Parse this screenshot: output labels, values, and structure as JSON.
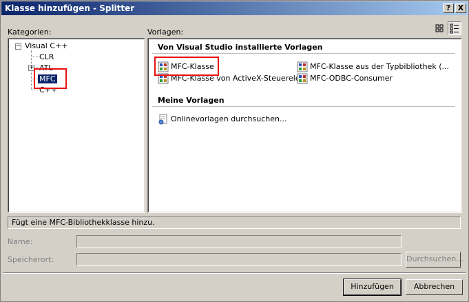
{
  "window": {
    "title": "Klasse hinzufügen - Splitter",
    "help_glyph": "?",
    "close_glyph": "X"
  },
  "categories": {
    "label": "Kategorien:",
    "tree": [
      {
        "label": "Visual C++",
        "expander": "−"
      },
      {
        "label": "CLR"
      },
      {
        "label": "ATL",
        "expander": "+"
      },
      {
        "label": "MFC",
        "selected": true
      },
      {
        "label": "C++"
      }
    ]
  },
  "templates": {
    "label": "Vorlagen:",
    "installed_heading": "Von Visual Studio installierte Vorlagen",
    "installed": [
      {
        "label": "MFC-Klasse",
        "icon": "mfc-class-icon"
      },
      {
        "label": "MFC-Klasse aus der Typbibliothek (...",
        "icon": "mfc-typelib-icon"
      },
      {
        "label": "MFC-Klasse von ActiveX-Steuerele...",
        "icon": "mfc-activex-icon"
      },
      {
        "label": "MFC-ODBC-Consumer",
        "icon": "mfc-odbc-icon"
      }
    ],
    "my_heading": "Meine Vorlagen",
    "my": [
      {
        "label": "Onlinevorlagen durchsuchen...",
        "icon": "online-search-icon"
      }
    ]
  },
  "description": "Fügt eine MFC-Bibliothekklasse hinzu.",
  "form": {
    "name_label": "Name:",
    "name_value": "",
    "location_label": "Speicherort:",
    "location_value": "",
    "browse_label": "Durchsuchen..."
  },
  "buttons": {
    "add": "Hinzufügen",
    "cancel": "Abbrechen"
  },
  "colors": {
    "titlebar_start": "#0a246a",
    "titlebar_end": "#a6caf0",
    "selection": "#0a246a",
    "annotation_red": "#e81010"
  }
}
